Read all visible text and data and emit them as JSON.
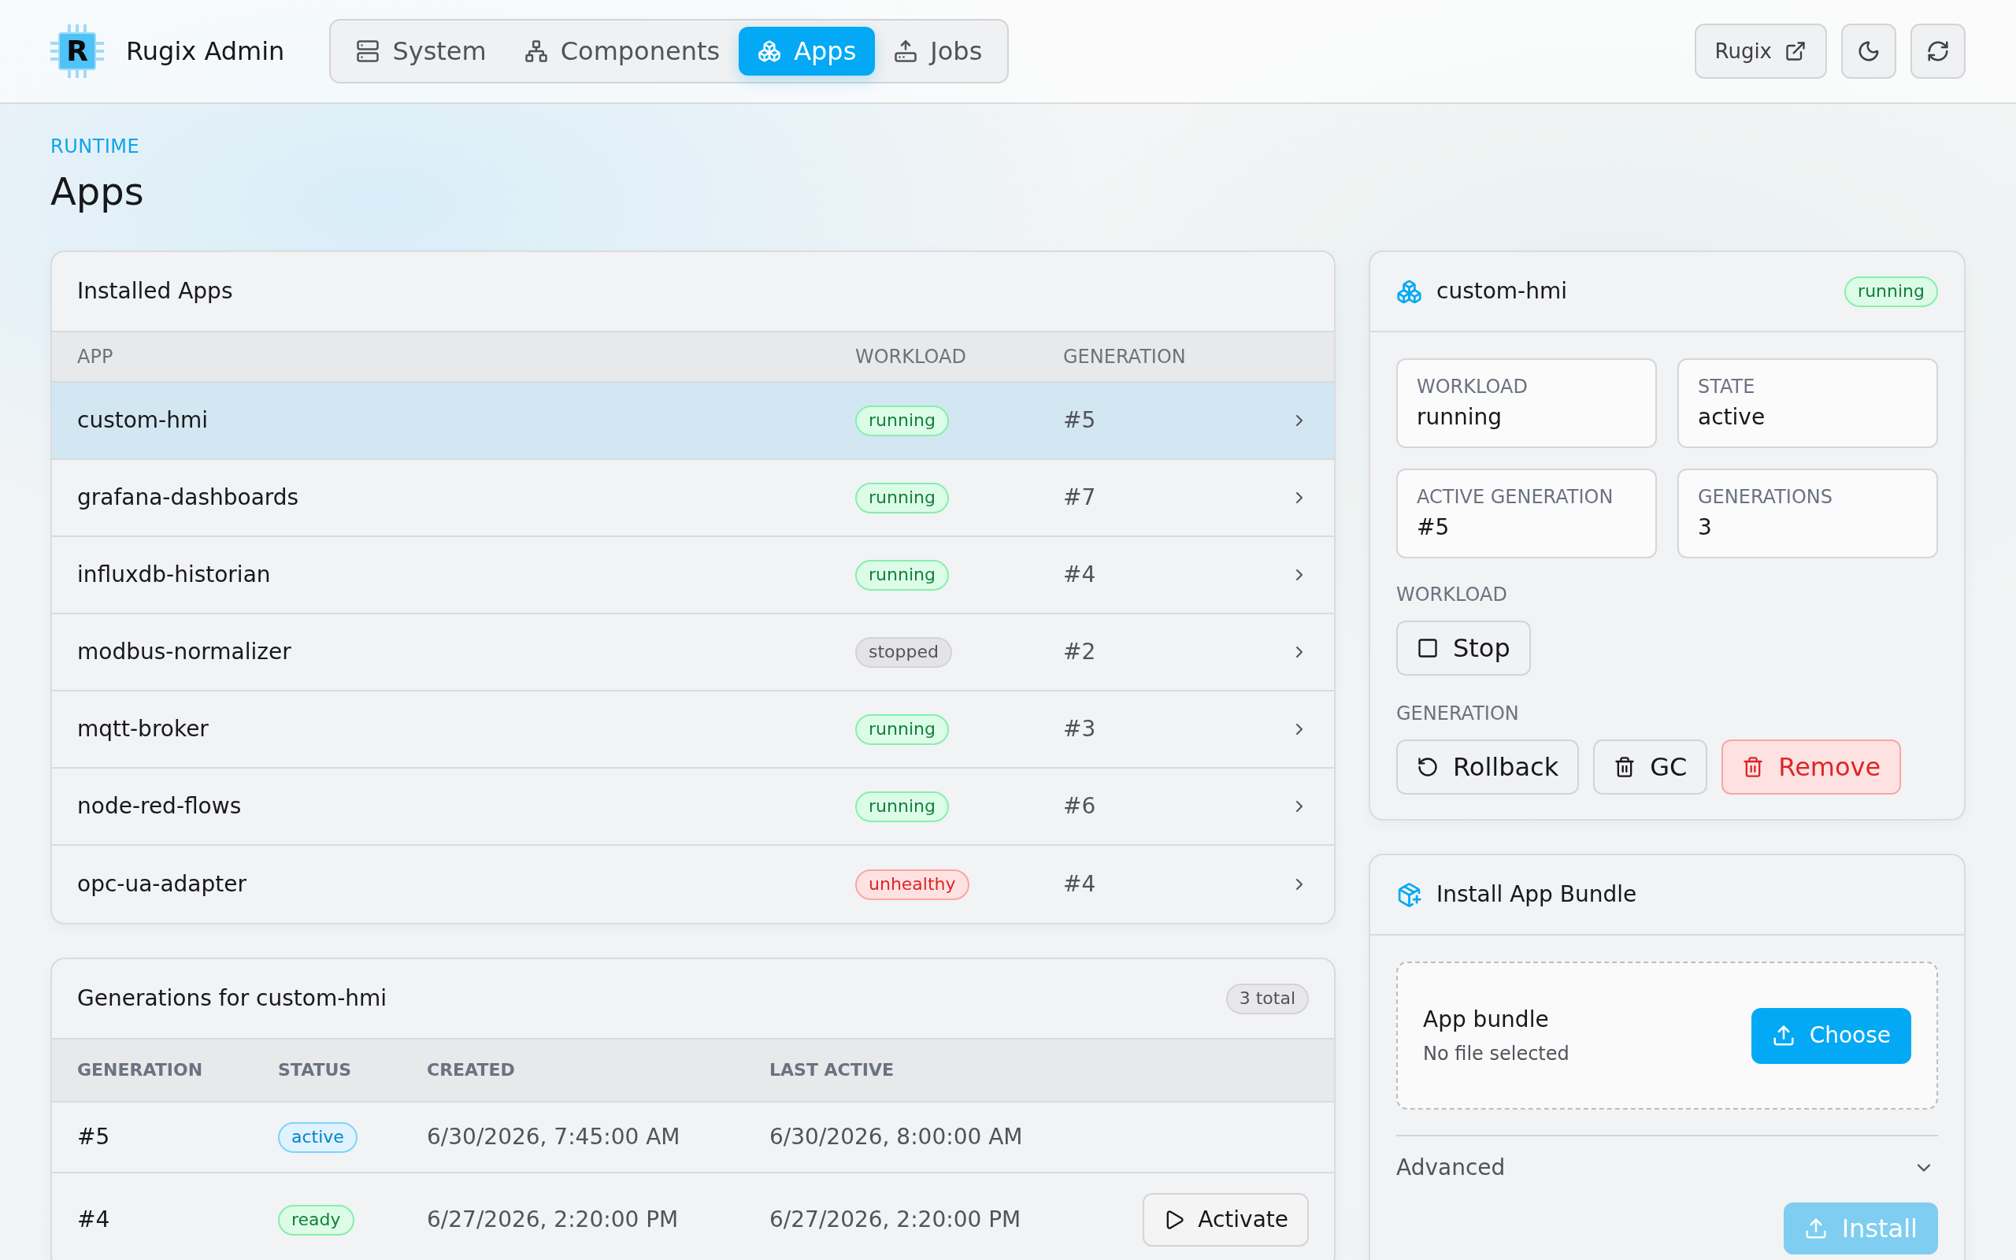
{
  "header": {
    "logo": "R",
    "brand": "Rugix Admin",
    "nav": [
      {
        "label": "System",
        "selected": false
      },
      {
        "label": "Components",
        "selected": false
      },
      {
        "label": "Apps",
        "selected": true
      },
      {
        "label": "Jobs",
        "selected": false
      }
    ],
    "link": "Rugix"
  },
  "page": {
    "eyebrow": "RUNTIME",
    "title": "Apps"
  },
  "installed_apps": {
    "title": "Installed Apps",
    "columns": [
      "APP",
      "WORKLOAD",
      "GENERATION"
    ],
    "rows": [
      {
        "app": "custom-hmi",
        "workload": {
          "text": "running",
          "kind": "success"
        },
        "generation": "#5",
        "selected": true
      },
      {
        "app": "grafana-dashboards",
        "workload": {
          "text": "running",
          "kind": "success"
        },
        "generation": "#7",
        "selected": false
      },
      {
        "app": "influxdb-historian",
        "workload": {
          "text": "running",
          "kind": "success"
        },
        "generation": "#4",
        "selected": false
      },
      {
        "app": "modbus-normalizer",
        "workload": {
          "text": "stopped",
          "kind": "neutral"
        },
        "generation": "#2",
        "selected": false
      },
      {
        "app": "mqtt-broker",
        "workload": {
          "text": "running",
          "kind": "success"
        },
        "generation": "#3",
        "selected": false
      },
      {
        "app": "node-red-flows",
        "workload": {
          "text": "running",
          "kind": "success"
        },
        "generation": "#6",
        "selected": false
      },
      {
        "app": "opc-ua-adapter",
        "workload": {
          "text": "unhealthy",
          "kind": "danger"
        },
        "generation": "#4",
        "selected": false
      }
    ]
  },
  "generations": {
    "title": "Generations for custom-hmi",
    "count": "3 total",
    "columns": [
      "GENERATION",
      "STATUS",
      "CREATED",
      "LAST ACTIVE"
    ],
    "rows": [
      {
        "generation": "#5",
        "status": {
          "text": "active",
          "kind": "info"
        },
        "created": "6/30/2026, 7:45:00 AM",
        "last_active": "6/30/2026, 8:00:00 AM"
      },
      {
        "generation": "#4",
        "status": {
          "text": "ready",
          "kind": "success"
        },
        "created": "6/27/2026, 2:20:00 PM",
        "last_active": "6/27/2026, 2:20:00 PM",
        "action": "Activate"
      }
    ]
  },
  "app_detail": {
    "name": "custom-hmi",
    "status": {
      "text": "running",
      "kind": "success"
    },
    "stats": [
      {
        "label": "WORKLOAD",
        "value": "running"
      },
      {
        "label": "STATE",
        "value": "active"
      },
      {
        "label": "ACTIVE GENERATION",
        "value": "#5"
      },
      {
        "label": "GENERATIONS",
        "value": "3"
      }
    ],
    "sections": [
      {
        "label": "WORKLOAD",
        "buttons": [
          {
            "label": "Stop",
            "kind": "default"
          }
        ]
      },
      {
        "label": "GENERATION",
        "buttons": [
          {
            "label": "Rollback",
            "kind": "default"
          },
          {
            "label": "GC",
            "kind": "default"
          },
          {
            "label": "Remove",
            "kind": "danger"
          }
        ]
      }
    ]
  },
  "install": {
    "title": "Install App Bundle",
    "file": {
      "label": "App bundle",
      "status": "No file selected",
      "button": "Choose"
    },
    "advanced": {
      "label": "Advanced",
      "expanded": false
    },
    "submit": {
      "label": "Install",
      "disabled": true
    }
  }
}
